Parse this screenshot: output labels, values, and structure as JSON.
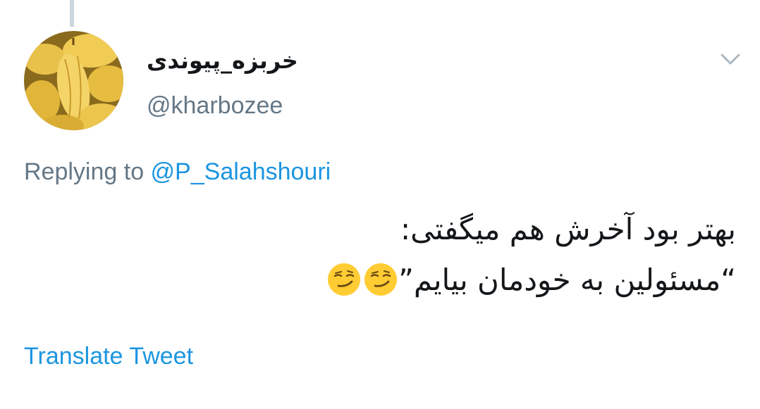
{
  "author": {
    "display_name": "خربزه_پیوندی",
    "handle": "@kharbozee",
    "avatar_icon": "melon-avatar"
  },
  "reply": {
    "prefix": "Replying to ",
    "mention": "@P_Salahshouri"
  },
  "tweet": {
    "line1": "بهتر بود آخرش هم میگفتی:",
    "line2": "“مسئولین به خودمان بیایم”",
    "emojis": [
      "smirking-face-emoji",
      "smirking-face-emoji"
    ]
  },
  "actions": {
    "translate_label": "Translate Tweet",
    "menu_icon": "chevron-down-icon"
  },
  "colors": {
    "link": "#1b95e0",
    "secondary_text": "#657786",
    "primary_text": "#14171a",
    "thread_line": "#cdd6dd"
  }
}
